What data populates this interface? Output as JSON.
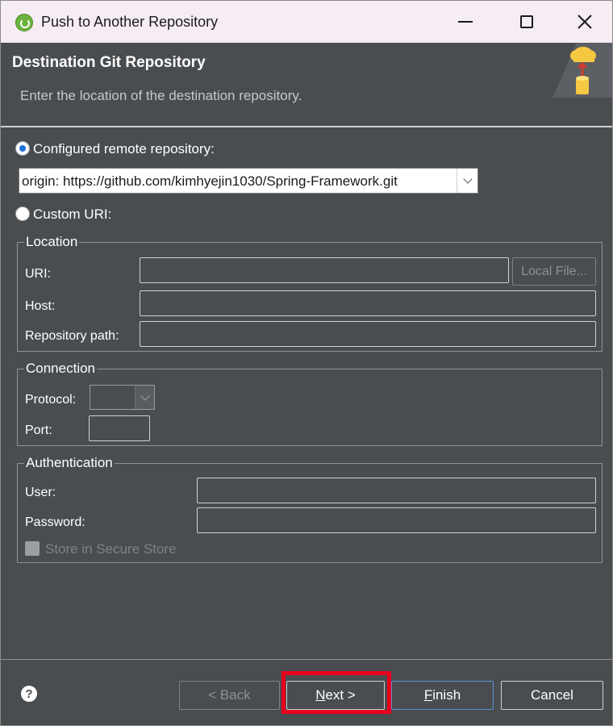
{
  "window": {
    "title": "Push to Another Repository"
  },
  "header": {
    "title": "Destination Git Repository",
    "description": "Enter the location of the destination repository."
  },
  "options": {
    "configured_label": "Configured remote repository:",
    "configured_selected": true,
    "remote_value": "origin: https://github.com/kimhyejin1030/Spring-Framework.git",
    "custom_label": "Custom URI:"
  },
  "location": {
    "group_label": "Location",
    "uri_label": "URI:",
    "uri_value": "",
    "local_file_label": "Local File...",
    "host_label": "Host:",
    "host_value": "",
    "path_label": "Repository path:",
    "path_value": ""
  },
  "connection": {
    "group_label": "Connection",
    "protocol_label": "Protocol:",
    "protocol_value": "",
    "port_label": "Port:",
    "port_value": ""
  },
  "authentication": {
    "group_label": "Authentication",
    "user_label": "User:",
    "user_value": "",
    "password_label": "Password:",
    "password_value": "",
    "secure_store_label": "Store in Secure Store"
  },
  "buttons": {
    "help_icon": "?",
    "back_label": "< Back",
    "next_mnemonic": "N",
    "next_rest": "ext >",
    "finish_mnemonic": "F",
    "finish_rest": "inish",
    "cancel_label": "Cancel"
  },
  "colors": {
    "background": "#4a4d50",
    "titlebar": "#f6ecf4",
    "highlight": "#e8001c",
    "accent": "#1f6fd6"
  },
  "icons": {
    "app": "spring-icon",
    "banner": "cloud-upload-repository-icon"
  }
}
